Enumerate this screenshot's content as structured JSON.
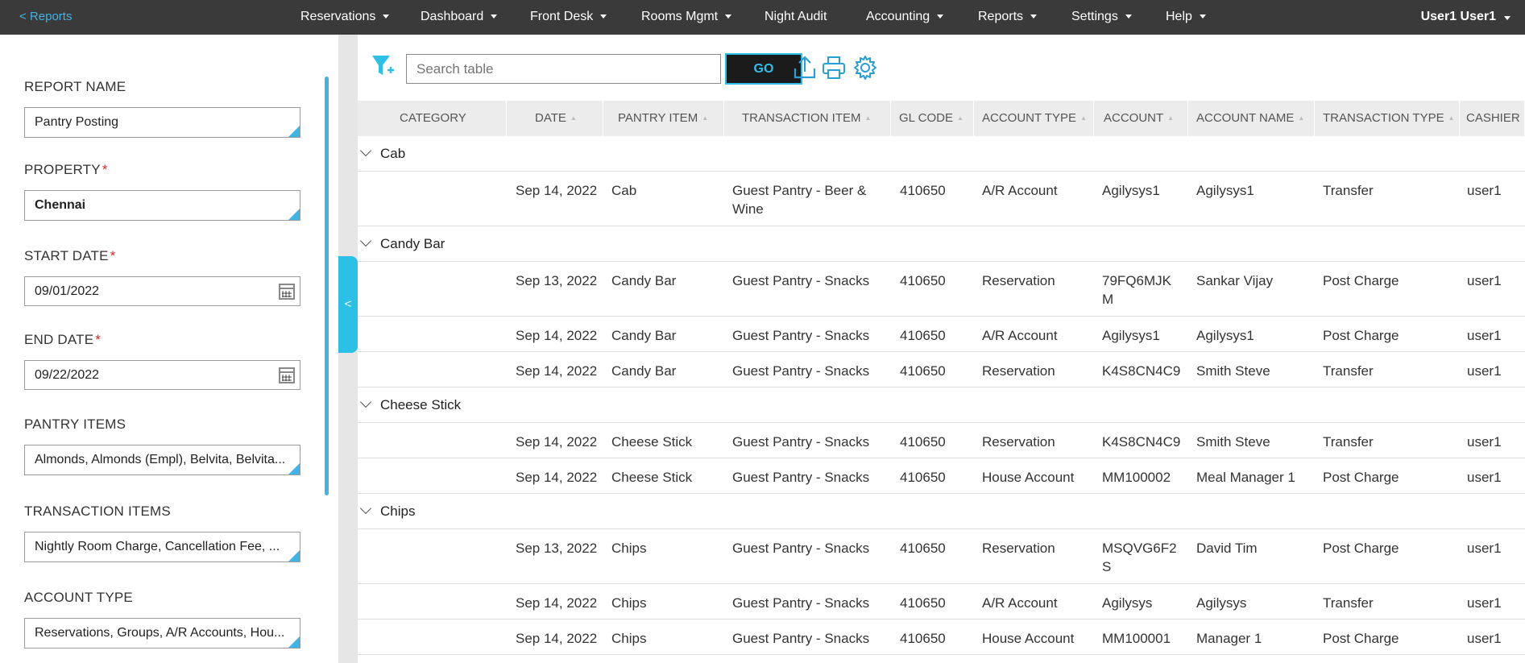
{
  "topbar": {
    "back_label": "< Reports",
    "nav": [
      {
        "label": "Reservations",
        "caret": true
      },
      {
        "label": "Dashboard",
        "caret": true
      },
      {
        "label": "Front Desk",
        "caret": true
      },
      {
        "label": "Rooms Mgmt",
        "caret": true
      },
      {
        "label": "Night Audit",
        "caret": false
      },
      {
        "label": "Accounting",
        "caret": true
      },
      {
        "label": "Reports",
        "caret": true
      },
      {
        "label": "Settings",
        "caret": true
      },
      {
        "label": "Help",
        "caret": true
      }
    ],
    "user": "User1 User1"
  },
  "filters": {
    "report_name": {
      "label": "REPORT NAME",
      "value": "Pantry Posting"
    },
    "property": {
      "label": "PROPERTY",
      "value": "Chennai",
      "required": "*"
    },
    "start_date": {
      "label": "START DATE",
      "value": "09/01/2022",
      "required": "*"
    },
    "end_date": {
      "label": "END DATE",
      "value": "09/22/2022",
      "required": "*"
    },
    "pantry_items": {
      "label": "PANTRY ITEMS",
      "value": "Almonds, Almonds (Empl), Belvita, Belvita..."
    },
    "transaction_items": {
      "label": "TRANSACTION ITEMS",
      "value": "Nightly Room Charge, Cancellation Fee, ..."
    },
    "account_type": {
      "label": "ACCOUNT TYPE",
      "value": "Reservations, Groups, A/R Accounts, Hou..."
    }
  },
  "collapse_label": "<",
  "toolbar": {
    "search_placeholder": "Search table",
    "go_label": "GO",
    "icons": [
      "filter-add-icon",
      "upload-icon",
      "print-icon",
      "gear-icon"
    ]
  },
  "colors": {
    "accent": "#2cc0e6",
    "topbar": "#3a3a3a",
    "required": "#e0252f"
  },
  "table": {
    "columns": [
      "CATEGORY",
      "DATE",
      "PANTRY ITEM",
      "TRANSACTION ITEM",
      "GL CODE",
      "ACCOUNT TYPE",
      "ACCOUNT",
      "ACCOUNT NAME",
      "TRANSACTION TYPE",
      "CASHIER"
    ],
    "groups": [
      {
        "name": "Cab",
        "rows": [
          {
            "date": "Sep 14, 2022",
            "pantry_item": "Cab",
            "transaction_item": "Guest Pantry - Beer &\nWine",
            "gl_code": "410650",
            "account_type": "A/R Account",
            "account": "Agilysys1",
            "account_name": "Agilysys1",
            "transaction_type": "Transfer",
            "cashier": "user1"
          }
        ]
      },
      {
        "name": "Candy Bar",
        "rows": [
          {
            "date": "Sep 13, 2022",
            "pantry_item": "Candy Bar",
            "transaction_item": "Guest Pantry - Snacks",
            "gl_code": "410650",
            "account_type": "Reservation",
            "account": "79FQ6MJK\nM",
            "account_name": "Sankar Vijay",
            "transaction_type": "Post Charge",
            "cashier": "user1"
          },
          {
            "date": "Sep 14, 2022",
            "pantry_item": "Candy Bar",
            "transaction_item": "Guest Pantry - Snacks",
            "gl_code": "410650",
            "account_type": "A/R Account",
            "account": "Agilysys1",
            "account_name": "Agilysys1",
            "transaction_type": "Post Charge",
            "cashier": "user1"
          },
          {
            "date": "Sep 14, 2022",
            "pantry_item": "Candy Bar",
            "transaction_item": "Guest Pantry - Snacks",
            "gl_code": "410650",
            "account_type": "Reservation",
            "account": "K4S8CN4C9",
            "account_name": "Smith Steve",
            "transaction_type": "Transfer",
            "cashier": "user1"
          }
        ]
      },
      {
        "name": "Cheese Stick",
        "rows": [
          {
            "date": "Sep 14, 2022",
            "pantry_item": "Cheese Stick",
            "transaction_item": "Guest Pantry - Snacks",
            "gl_code": "410650",
            "account_type": "Reservation",
            "account": "K4S8CN4C9",
            "account_name": "Smith Steve",
            "transaction_type": "Transfer",
            "cashier": "user1"
          },
          {
            "date": "Sep 14, 2022",
            "pantry_item": "Cheese Stick",
            "transaction_item": "Guest Pantry - Snacks",
            "gl_code": "410650",
            "account_type": "House Account",
            "account": "MM100002",
            "account_name": "Meal Manager 1",
            "transaction_type": "Post Charge",
            "cashier": "user1"
          }
        ]
      },
      {
        "name": "Chips",
        "rows": [
          {
            "date": "Sep 13, 2022",
            "pantry_item": "Chips",
            "transaction_item": "Guest Pantry - Snacks",
            "gl_code": "410650",
            "account_type": "Reservation",
            "account": "MSQVG6F2\nS",
            "account_name": "David Tim",
            "transaction_type": "Post Charge",
            "cashier": "user1"
          },
          {
            "date": "Sep 14, 2022",
            "pantry_item": "Chips",
            "transaction_item": "Guest Pantry - Snacks",
            "gl_code": "410650",
            "account_type": "A/R Account",
            "account": "Agilysys",
            "account_name": "Agilysys",
            "transaction_type": "Transfer",
            "cashier": "user1"
          },
          {
            "date": "Sep 14, 2022",
            "pantry_item": "Chips",
            "transaction_item": "Guest Pantry - Snacks",
            "gl_code": "410650",
            "account_type": "House Account",
            "account": "MM100001",
            "account_name": "Manager 1",
            "transaction_type": "Post Charge",
            "cashier": "user1"
          }
        ]
      }
    ]
  }
}
